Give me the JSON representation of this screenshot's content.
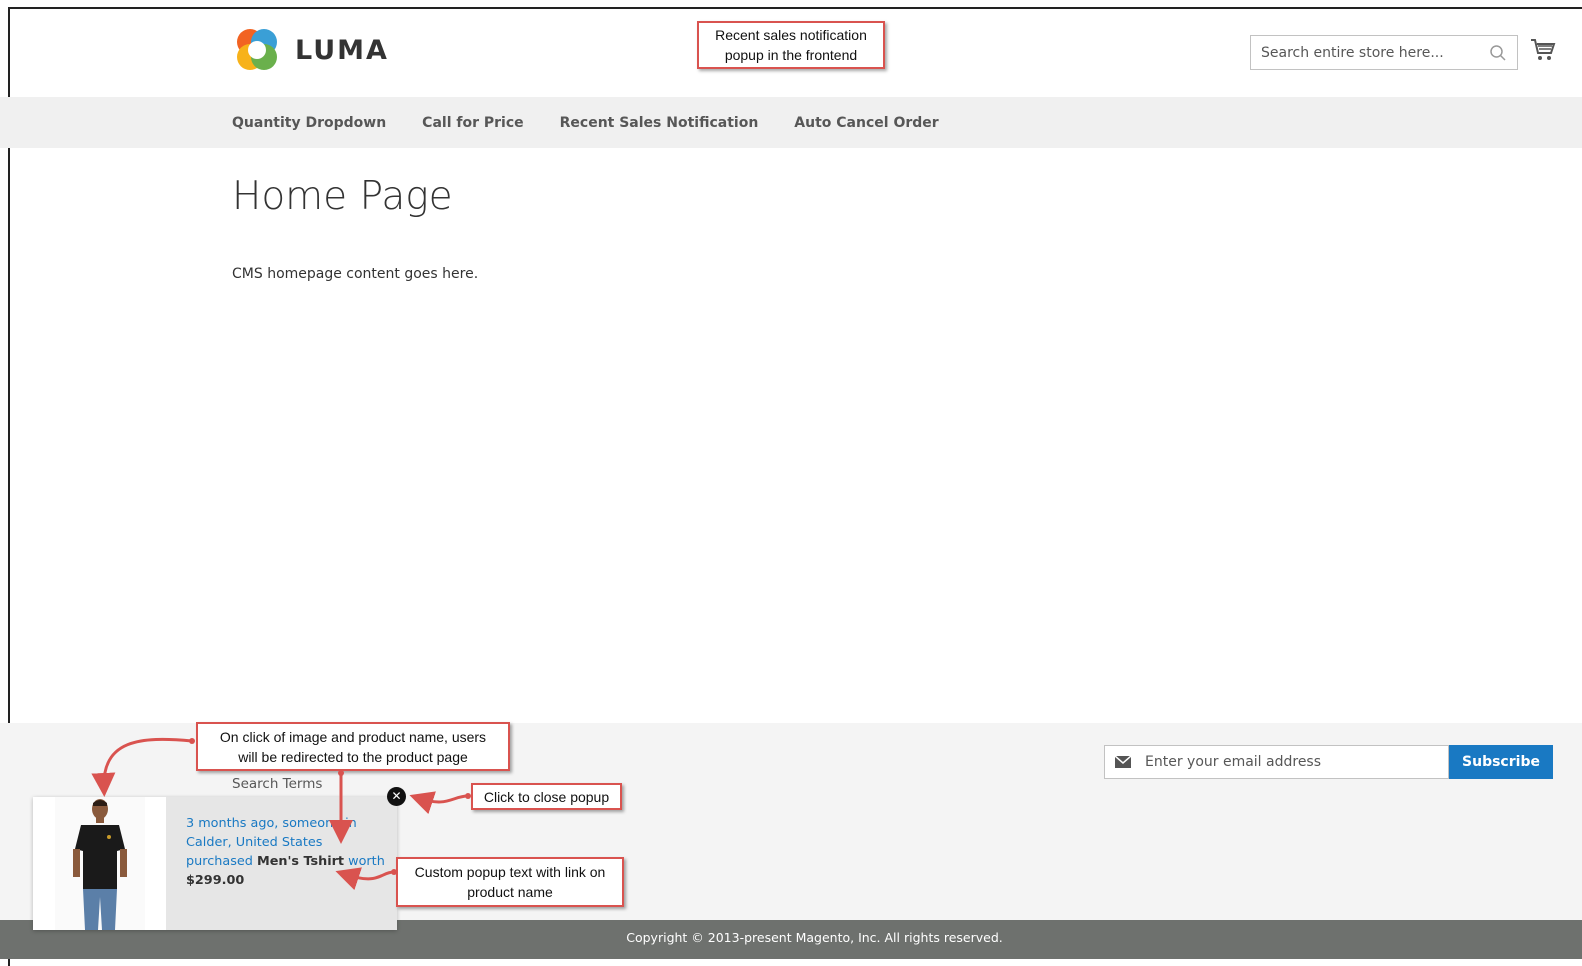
{
  "header": {
    "logo_text": "LUMA",
    "search_placeholder": "Search entire store here..."
  },
  "nav": {
    "items": [
      "Quantity Dropdown",
      "Call for Price",
      "Recent Sales Notification",
      "Auto Cancel Order"
    ]
  },
  "main": {
    "title": "Home Page",
    "content": "CMS homepage content goes here."
  },
  "footer": {
    "search_terms": "Search Terms",
    "newsletter_placeholder": "Enter your email address",
    "subscribe_label": "Subscribe",
    "copyright": "Copyright © 2013-present Magento, Inc. All rights reserved."
  },
  "popup": {
    "line_1": "3 months ago, someone in",
    "line_2": "Calder, United States",
    "purchased": "purchased",
    "product_name": "Men's Tshirt",
    "worth": "worth",
    "price": "$299.00"
  },
  "annotations": {
    "top": [
      "Recent sales notification",
      "popup in the frontend"
    ],
    "redirect": [
      "On click of image and product name, users",
      "will be redirected to the product page"
    ],
    "close": "Click to close popup",
    "custom": [
      "Custom popup text with link on",
      "product name"
    ]
  },
  "colors": {
    "accent": "#1979c3",
    "nav_bg": "#f0f0f0",
    "footer_bg": "#f4f4f4",
    "copyright_bg": "#6e716e",
    "callout_border": "#d9534f"
  }
}
